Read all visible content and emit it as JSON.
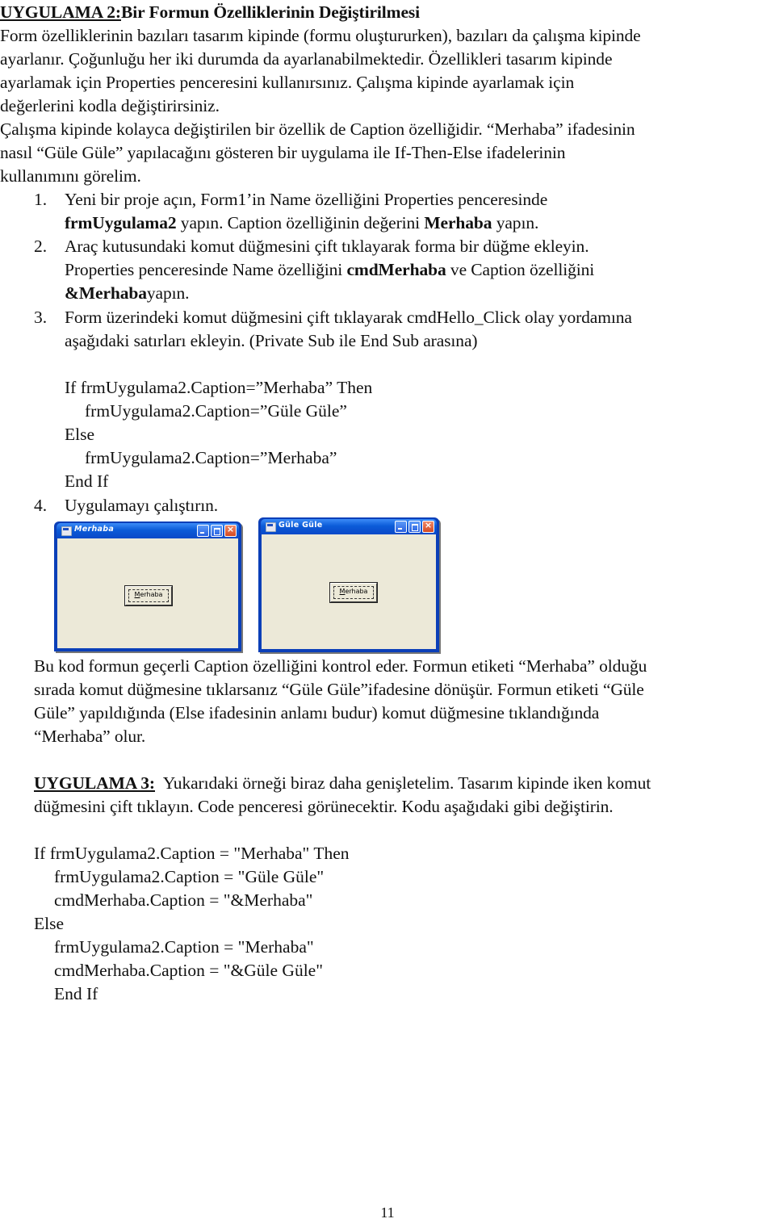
{
  "section2": {
    "heading_prefix": "UYGULAMA 2:",
    "heading_rest": "Bir Formun Özelliklerinin Değiştirilmesi",
    "intro_lines": [
      "Form özelliklerinin bazıları tasarım kipinde (formu oluştururken), bazıları da çalışma kipinde",
      "ayarlanır. Çoğunluğu her iki durumda da ayarlanabilmektedir. Özellikleri tasarım kipinde",
      "ayarlamak için Properties penceresini kullanırsınız. Çalışma kipinde ayarlamak için",
      "değerlerini kodla değiştirirsiniz.",
      "Çalışma kipinde kolayca değiştirilen bir özellik de Caption özelliğidir.  “Merhaba” ifadesinin",
      "nasıl “Güle Güle” yapılacağını gösteren bir uygulama ile If-Then-Else ifadelerinin",
      "kullanımını görelim."
    ],
    "steps": [
      {
        "number": "1.",
        "line1": "Yeni bir proje açın, Form1’in Name özelliğini Properties penceresinde",
        "line2_bold1": "frmUygulama2",
        "line2_text1": " yapın. Caption özelliğinin değerini ",
        "line2_bold2": "Merhaba",
        "line2_text2": " yapın."
      },
      {
        "number": "2.",
        "line1": "Araç kutusundaki komut düğmesini çift tıklayarak forma bir düğme ekleyin.",
        "line2_text1": "Properties penceresinde Name özelliğini ",
        "line2_bold1": "cmdMerhaba",
        "line2_text2": " ve Caption özelliğini",
        "line3_bold": "&Merhaba",
        "line3_text": "yapın."
      },
      {
        "number": "3.",
        "line1": "Form üzerindeki komut düğmesini çift tıklayarak cmdHello_Click olay yordamına",
        "line2": "aşağıdaki satırları ekleyin. (Private Sub ile End Sub arasına)"
      },
      {
        "number": "4.",
        "line1": "Uygulamayı çalıştırın."
      }
    ],
    "code_lines": [
      "If frmUygulama2.Caption=”Merhaba” Then",
      "frmUygulama2.Caption=”Güle Güle”",
      "Else",
      "frmUygulama2.Caption=”Merhaba”",
      "End If"
    ],
    "screenshots": [
      {
        "window_title": "Merhaba",
        "button_label": "Merhaba",
        "button_accel_key": "M"
      },
      {
        "window_title": "Güle Güle",
        "button_label": "Merhaba",
        "button_accel_key": "M"
      }
    ],
    "explanation_lines": [
      "Bu kod formun geçerli Caption özelliğini kontrol eder. Formun etiketi “Merhaba” olduğu",
      "sırada komut düğmesine tıklarsanız “Güle Güle”ifadesine dönüşür. Formun etiketi “Güle",
      "Güle” yapıldığında (Else ifadesinin anlamı budur) komut düğmesine tıklandığında",
      "“Merhaba” olur."
    ]
  },
  "section3": {
    "heading": "UYGULAMA 3:",
    "line1_rest": "  Yukarıdaki örneği biraz daha genişletelim. Tasarım kipinde iken komut",
    "line2": "düğmesini çift tıklayın. Code penceresi görünecektir. Kodu aşağıdaki gibi değiştirin.",
    "code_lines": [
      "If frmUygulama2.Caption = \"Merhaba\" Then",
      "frmUygulama2.Caption = \"Güle Güle\"",
      "cmdMerhaba.Caption = \"&Merhaba\"",
      "Else",
      "frmUygulama2.Caption = \"Merhaba\"",
      "cmdMerhaba.Caption = \"&Güle Güle\"",
      "End If"
    ]
  },
  "page_number": "11",
  "colors": {
    "xp_titlebar": "#0b5bd8",
    "xp_client": "#ece9d8",
    "xp_close": "#d44a22"
  }
}
